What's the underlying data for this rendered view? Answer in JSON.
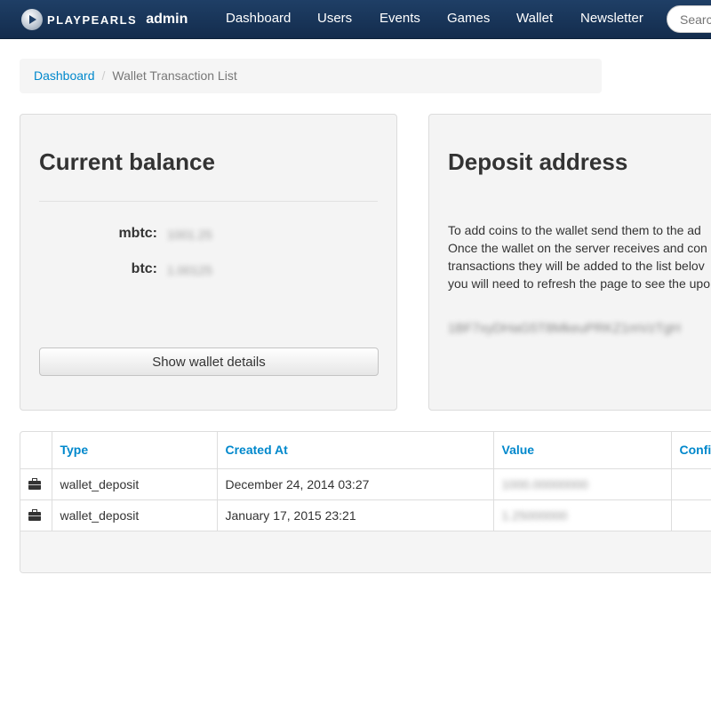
{
  "navbar": {
    "brand_text": "PLAYPEARLS",
    "brand_admin": "admin",
    "items": [
      {
        "label": "Dashboard"
      },
      {
        "label": "Users"
      },
      {
        "label": "Events"
      },
      {
        "label": "Games"
      },
      {
        "label": "Wallet"
      },
      {
        "label": "Newsletter"
      }
    ],
    "search_placeholder": "Search"
  },
  "breadcrumb": {
    "home": "Dashboard",
    "separator": "/",
    "current": "Wallet Transaction List"
  },
  "balance_panel": {
    "title": "Current balance",
    "mbtc_label": "mbtc:",
    "mbtc_value": "1001.25",
    "btc_label": "btc:",
    "btc_value": "1.00125",
    "button_label": "Show wallet details"
  },
  "deposit_panel": {
    "title": "Deposit address",
    "text": "To add coins to the wallet send them to the ad\nOnce the wallet on the server receives and con\ntransactions they will be added to the list belov\nyou will need to refresh the page to see the upo",
    "address": "1BF7xyDHaG5T8MkeuPRKZ1mVzTgH"
  },
  "transactions": {
    "columns": [
      "",
      "Type",
      "Created At",
      "Value",
      "Confi"
    ],
    "rows": [
      {
        "icon": "briefcase-icon",
        "type": "wallet_deposit",
        "created_at": "December 24, 2014 03:27",
        "value": "1000.00000000",
        "confirmations": ""
      },
      {
        "icon": "briefcase-icon",
        "type": "wallet_deposit",
        "created_at": "January 17, 2015 23:21",
        "value": "1.25000000",
        "confirmations": ""
      }
    ]
  },
  "colors": {
    "navbar": "#1a365a",
    "link": "#0088cc",
    "panel_bg": "#f4f4f4"
  }
}
